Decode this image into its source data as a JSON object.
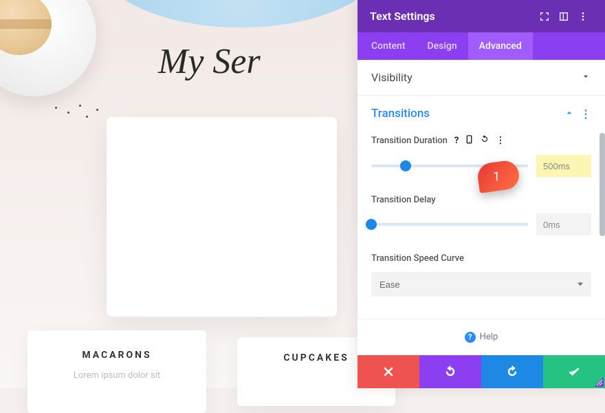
{
  "scene": {
    "heading": "My Ser",
    "cards": {
      "macaron_title": "MACARONS",
      "macaron_sub": "Lorem ipsum dolor sit",
      "cupcake_title": "CUPCAKES"
    }
  },
  "panel": {
    "title": "Text Settings",
    "tabs": {
      "content": "Content",
      "design": "Design",
      "advanced": "Advanced"
    },
    "sections": {
      "visibility": "Visibility",
      "transitions": "Transitions"
    },
    "fields": {
      "duration_label": "Transition Duration",
      "duration_value": "500ms",
      "duration_pct": 22,
      "delay_label": "Transition Delay",
      "delay_value": "0ms",
      "delay_pct": 0,
      "curve_label": "Transition Speed Curve",
      "curve_value": "Ease"
    },
    "help": "Help"
  },
  "callout": {
    "num": "1"
  }
}
